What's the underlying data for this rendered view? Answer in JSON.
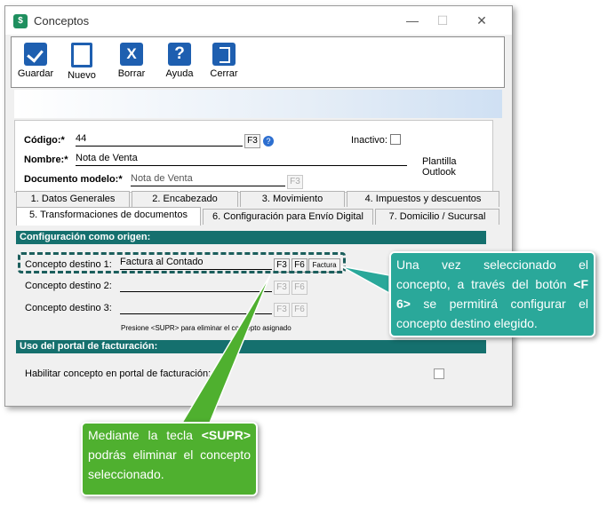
{
  "window": {
    "title": "Conceptos",
    "minimize": "—",
    "maximize": "☐",
    "close": "✕"
  },
  "toolbar": {
    "buttons": [
      {
        "label": "Guardar",
        "icon": "save-icon"
      },
      {
        "label": "Nuevo",
        "icon": "new-document-icon"
      },
      {
        "label": "Borrar",
        "icon": "delete-icon",
        "glyph": "X"
      },
      {
        "label": "Ayuda",
        "icon": "help-icon",
        "glyph": "?"
      },
      {
        "label": "Cerrar",
        "icon": "exit-icon"
      }
    ]
  },
  "form": {
    "codigo_label": "Código:*",
    "codigo_value": "44",
    "f3": "F3",
    "inactivo_label": "Inactivo:",
    "nombre_label": "Nombre:*",
    "nombre_value": "Nota de Venta",
    "plantilla_label": "Plantilla Outlook",
    "doc_modelo_label": "Documento modelo:*",
    "doc_modelo_value": "Nota de Venta"
  },
  "tabs": {
    "row1": [
      "1. Datos Generales",
      "2. Encabezado",
      "3. Movimiento",
      "4. Impuestos y descuentos"
    ],
    "row2": [
      "5. Transformaciones de documentos",
      "6. Configuración para Envío Digital",
      "7. Domicilio / Sucursal"
    ]
  },
  "origen": {
    "header": "Configuración como origen:",
    "destino1_label": "Concepto destino 1:",
    "destino1_value": "Factura al Contado",
    "destino1_extra": "Factura",
    "destino2_label": "Concepto destino 2:",
    "destino3_label": "Concepto destino 3:",
    "f3": "F3",
    "f6": "F6",
    "note": "Presione <SUPR> para eliminar el concepto asignado"
  },
  "portal": {
    "header": "Uso del portal de facturación:",
    "habilitar_label": "Habilitar concepto en portal de facturación:"
  },
  "callouts": {
    "right": {
      "pre": "Una vez seleccionado el concepto, a través del botón ",
      "key": "<F 6>",
      "post": " se permitirá configurar el concepto destino elegido."
    },
    "bottom": {
      "pre": "Mediante la tecla ",
      "key": "<SUPR>",
      "post": " podrás eliminar el concepto seleccionado."
    }
  },
  "colors": {
    "section": "#15706e",
    "callout_right": "#2aa89a",
    "callout_bottom": "#4fb02f",
    "toolbar_icon": "#1e5fb0"
  }
}
